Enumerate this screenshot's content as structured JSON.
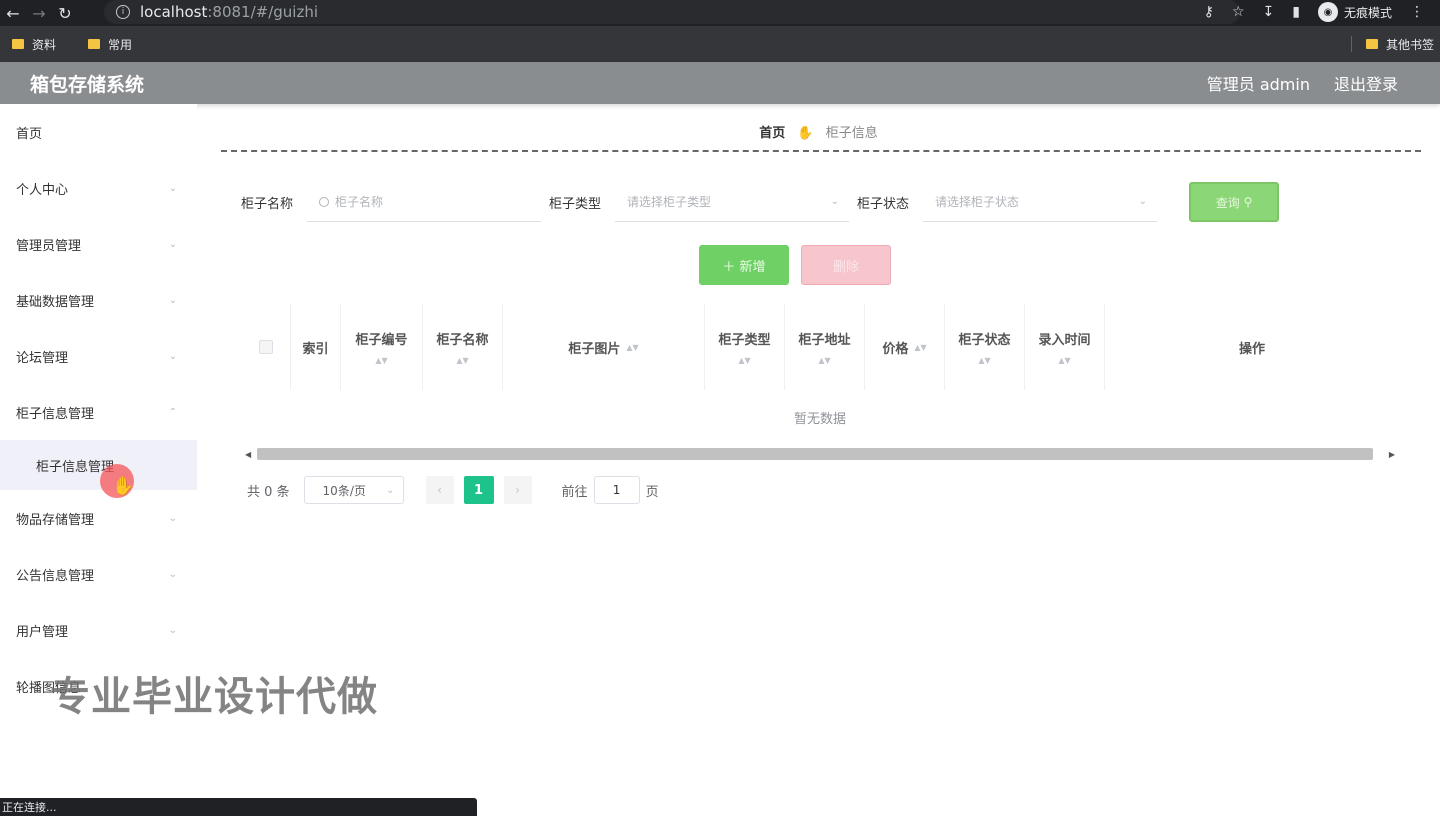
{
  "browser": {
    "url_host": "localhost",
    "url_path": ":8081/#/guizhi",
    "incognito_label": "无痕模式",
    "bookmarks": [
      "资料",
      "常用"
    ],
    "other_bookmarks": "其他书签",
    "status_text": "正在连接..."
  },
  "header": {
    "title": "箱包存储系统",
    "user": "管理员 admin",
    "logout": "退出登录"
  },
  "sidebar": {
    "items": [
      {
        "label": "首页"
      },
      {
        "label": "个人中心"
      },
      {
        "label": "管理员管理"
      },
      {
        "label": "基础数据管理"
      },
      {
        "label": "论坛管理"
      },
      {
        "label": "柜子信息管理"
      },
      {
        "label": "物品存储管理"
      },
      {
        "label": "公告信息管理"
      },
      {
        "label": "用户管理"
      },
      {
        "label": "轮播图信息"
      }
    ],
    "submenu": {
      "label": "柜子信息管理"
    }
  },
  "breadcrumb": {
    "home": "首页",
    "current": "柜子信息"
  },
  "search": {
    "name_label": "柜子名称",
    "name_placeholder": "柜子名称",
    "type_label": "柜子类型",
    "type_placeholder": "请选择柜子类型",
    "status_label": "柜子状态",
    "status_placeholder": "请选择柜子状态",
    "search_btn": "查询"
  },
  "actions": {
    "add": "＋ 新增",
    "delete": "删除"
  },
  "table": {
    "columns": [
      "索引",
      "柜子编号",
      "柜子名称",
      "柜子图片",
      "柜子类型",
      "柜子地址",
      "价格",
      "柜子状态",
      "录入时间",
      "操作"
    ],
    "empty_text": "暂无数据"
  },
  "pager": {
    "total": "共 0 条",
    "page_size": "10条/页",
    "current": "1",
    "goto_label": "前往",
    "goto_value": "1",
    "page_unit": "页"
  },
  "watermark": "专业毕业设计代做"
}
